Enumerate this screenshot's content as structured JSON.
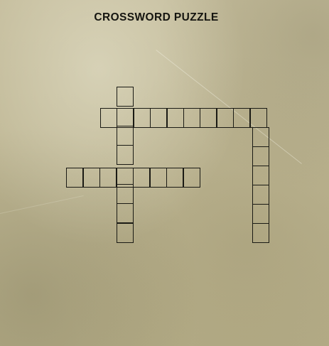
{
  "title": "CROSSWORD PUZZLE",
  "colors": {
    "paper": "#bdb592",
    "ink": "#1a1a14"
  },
  "puzzle": {
    "words": [
      {
        "id": "across-top",
        "direction": "across",
        "length": 10
      },
      {
        "id": "across-middle",
        "direction": "across",
        "length": 8
      },
      {
        "id": "down-left",
        "direction": "down",
        "length": 8
      },
      {
        "id": "down-right",
        "direction": "down",
        "length": 7
      }
    ]
  }
}
